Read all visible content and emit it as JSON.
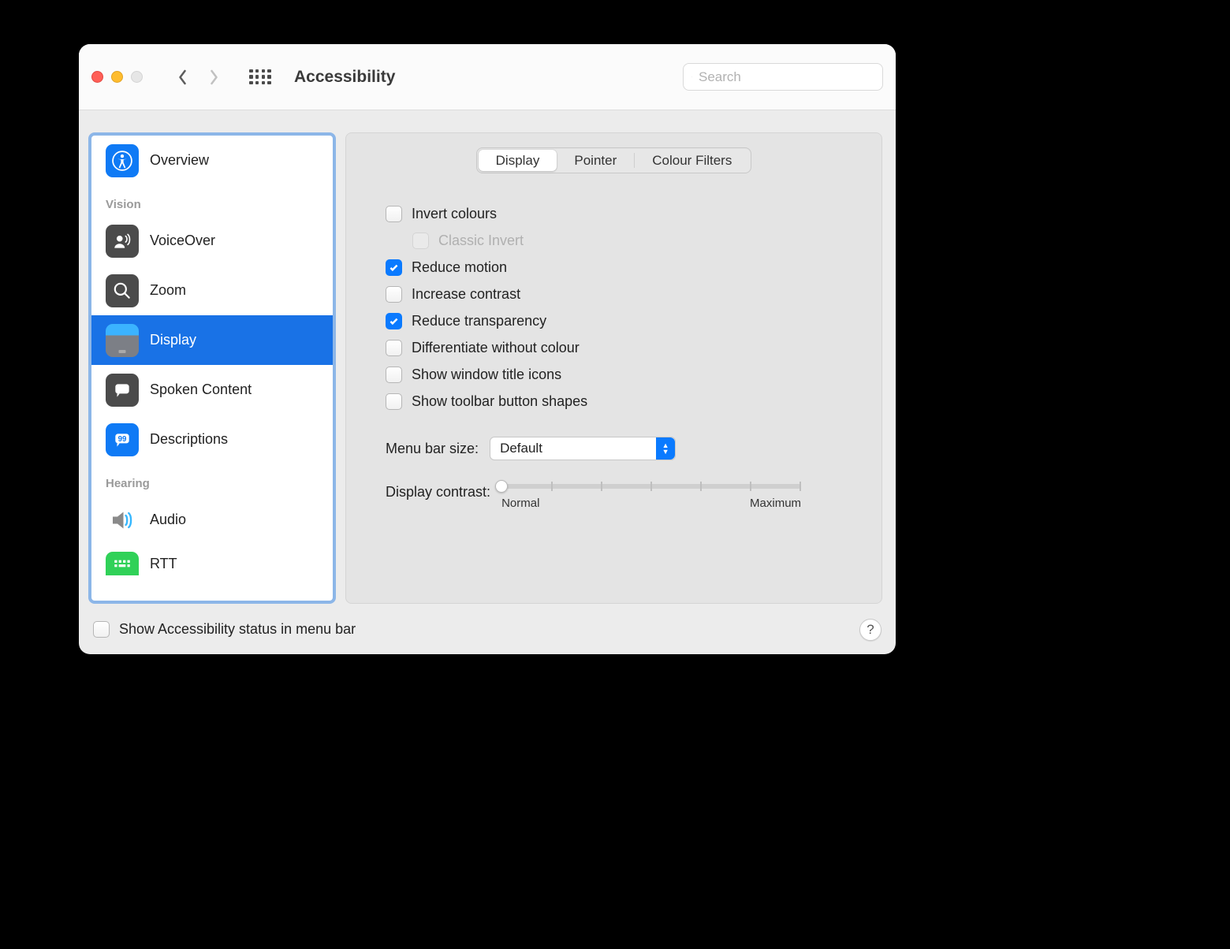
{
  "window_title": "Accessibility",
  "search": {
    "placeholder": "Search"
  },
  "sidebar": {
    "overview": "Overview",
    "sections": {
      "vision": "Vision",
      "hearing": "Hearing"
    },
    "items": {
      "voiceover": "VoiceOver",
      "zoom": "Zoom",
      "display": "Display",
      "spoken_content": "Spoken Content",
      "descriptions": "Descriptions",
      "audio": "Audio",
      "rtt": "RTT"
    }
  },
  "tabs": {
    "display": "Display",
    "pointer": "Pointer",
    "colour_filters": "Colour Filters"
  },
  "options": {
    "invert_colours": {
      "label": "Invert colours",
      "checked": false
    },
    "classic_invert": {
      "label": "Classic Invert",
      "checked": false,
      "disabled": true
    },
    "reduce_motion": {
      "label": "Reduce motion",
      "checked": true
    },
    "increase_contrast": {
      "label": "Increase contrast",
      "checked": false
    },
    "reduce_transparency": {
      "label": "Reduce transparency",
      "checked": true
    },
    "differentiate_without_colour": {
      "label": "Differentiate without colour",
      "checked": false
    },
    "show_window_title_icons": {
      "label": "Show window title icons",
      "checked": false
    },
    "show_toolbar_button_shapes": {
      "label": "Show toolbar button shapes",
      "checked": false
    }
  },
  "menubar": {
    "label": "Menu bar size:",
    "value": "Default"
  },
  "contrast": {
    "label": "Display contrast:",
    "min_label": "Normal",
    "max_label": "Maximum"
  },
  "footer": {
    "status_checkbox_label": "Show Accessibility status in menu bar",
    "status_checked": false
  },
  "help_label": "?"
}
